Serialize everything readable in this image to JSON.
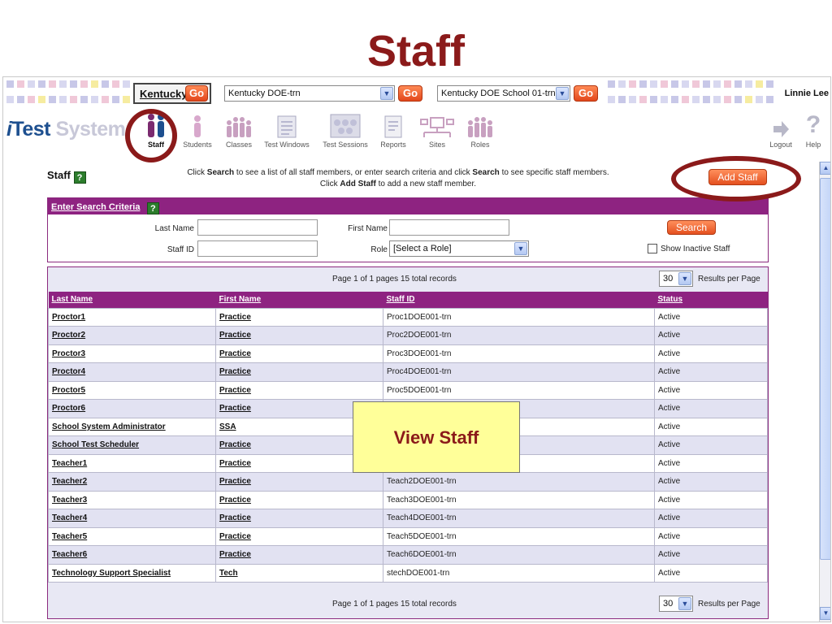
{
  "slide": {
    "title": "Staff",
    "callout": "View Staff"
  },
  "topbar": {
    "state_link": "Kentucky",
    "go_label": "Go",
    "district_select": "Kentucky DOE-trn",
    "school_select": "Kentucky DOE School 01-trn",
    "user_name": "Linnie Lee"
  },
  "nav": {
    "logo_i": "i",
    "logo_test": "Test ",
    "logo_system": "System",
    "items": [
      {
        "label": "Staff",
        "icon": "staff-icon"
      },
      {
        "label": "Students",
        "icon": "students-icon"
      },
      {
        "label": "Classes",
        "icon": "classes-icon"
      },
      {
        "label": "Test Windows",
        "icon": "test-windows-icon"
      },
      {
        "label": "Test Sessions",
        "icon": "test-sessions-icon"
      },
      {
        "label": "Reports",
        "icon": "reports-icon"
      },
      {
        "label": "Sites",
        "icon": "sites-icon"
      },
      {
        "label": "Roles",
        "icon": "roles-icon"
      }
    ],
    "logout": "Logout",
    "help": "Help"
  },
  "page": {
    "title": "Staff",
    "help_glyph": "?",
    "instr_1": "to see a list of all staff members, or enter search criteria and click",
    "instr_2": "to see specific staff members.",
    "instr_3": "to add a new staff member.",
    "instr_click": "Click",
    "instr_search": "Search",
    "instr_add_staff": "Add Staff",
    "add_staff_button": "Add Staff"
  },
  "criteria": {
    "header": "Enter Search Criteria",
    "last_name_label": "Last Name",
    "first_name_label": "First Name",
    "staff_id_label": "Staff ID",
    "role_label": "Role",
    "role_value": "[Select a Role]",
    "search_button": "Search",
    "show_inactive": "Show Inactive Staff"
  },
  "results": {
    "page_info": "Page  1  of 1 pages      15 total records",
    "per_page_value": "30",
    "per_page_label": "Results per Page",
    "columns": [
      "Last Name",
      "First Name",
      "Staff ID",
      "Status"
    ],
    "rows": [
      [
        "Proctor1",
        "Practice",
        "Proc1DOE001-trn",
        "Active"
      ],
      [
        "Proctor2",
        "Practice",
        "Proc2DOE001-trn",
        "Active"
      ],
      [
        "Proctor3",
        "Practice",
        "Proc3DOE001-trn",
        "Active"
      ],
      [
        "Proctor4",
        "Practice",
        "Proc4DOE001-trn",
        "Active"
      ],
      [
        "Proctor5",
        "Practice",
        "Proc5DOE001-trn",
        "Active"
      ],
      [
        "Proctor6",
        "Practice",
        "",
        "Active"
      ],
      [
        "School System Administrator",
        "SSA",
        "",
        "Active"
      ],
      [
        "School Test Scheduler",
        "Practice",
        "",
        "Active"
      ],
      [
        "Teacher1",
        "Practice",
        "",
        "Active"
      ],
      [
        "Teacher2",
        "Practice",
        "Teach2DOE001-trn",
        "Active"
      ],
      [
        "Teacher3",
        "Practice",
        "Teach3DOE001-trn",
        "Active"
      ],
      [
        "Teacher4",
        "Practice",
        "Teach4DOE001-trn",
        "Active"
      ],
      [
        "Teacher5",
        "Practice",
        "Teach5DOE001-trn",
        "Active"
      ],
      [
        "Teacher6",
        "Practice",
        "Teach6DOE001-trn",
        "Active"
      ],
      [
        "Technology Support Specialist",
        "Tech",
        "stechDOE001-trn",
        "Active"
      ]
    ]
  }
}
